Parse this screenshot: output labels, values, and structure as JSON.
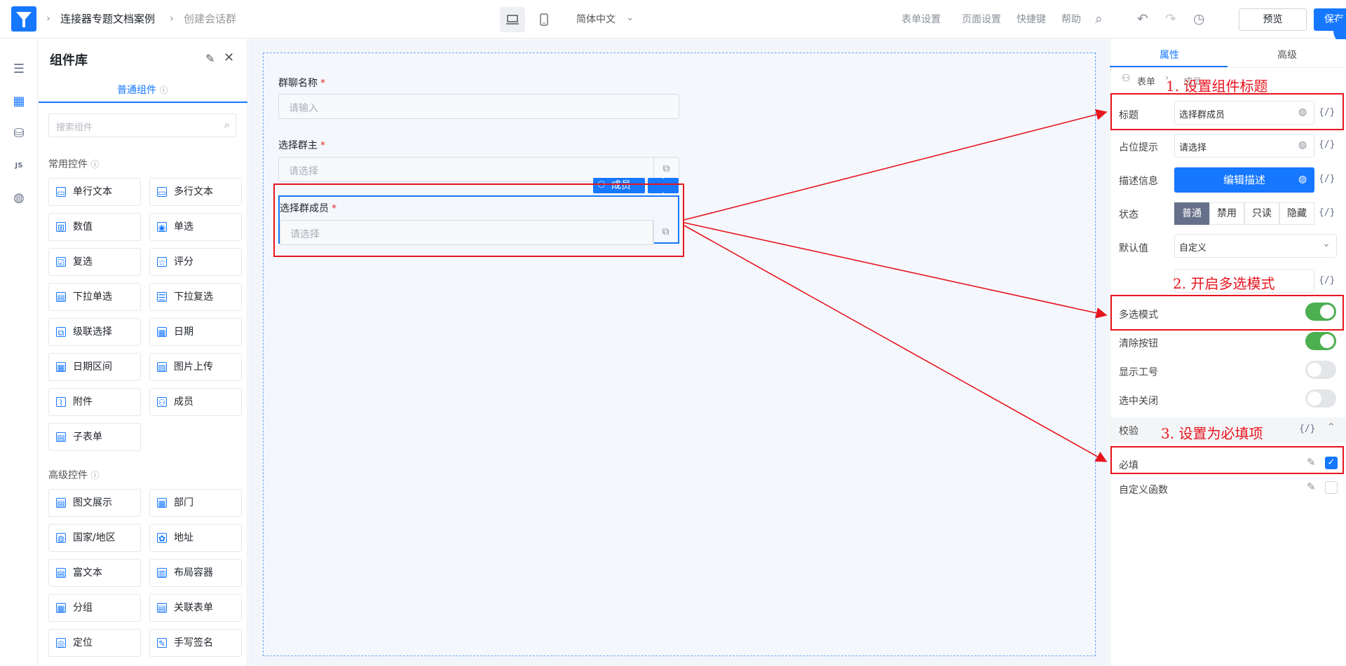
{
  "topbar": {
    "breadcrumb": [
      "连接器专题文档案例",
      "创建会话群"
    ],
    "language": "简体中文",
    "links": [
      "表单设置",
      "页面设置",
      "快捷键",
      "帮助"
    ],
    "preview_label": "预览",
    "save_label": "保存"
  },
  "library": {
    "title": "组件库",
    "tab": "普通组件",
    "search_placeholder": "搜索组件",
    "common_title": "常用控件",
    "common": [
      "单行文本",
      "多行文本",
      "数值",
      "单选",
      "复选",
      "评分",
      "下拉单选",
      "下拉复选",
      "级联选择",
      "日期",
      "日期区间",
      "图片上传",
      "附件",
      "成员",
      "子表单"
    ],
    "advanced_title": "高级控件",
    "advanced": [
      "图文展示",
      "部门",
      "国家/地区",
      "地址",
      "富文本",
      "布局容器",
      "分组",
      "关联表单",
      "定位",
      "手写签名"
    ]
  },
  "form": {
    "fields": [
      {
        "label": "群聊名称",
        "placeholder": "请输入"
      },
      {
        "label": "选择群主",
        "placeholder": "请选择"
      },
      {
        "label": "选择群成员",
        "placeholder": "请选择"
      }
    ],
    "selected_tag": "成员"
  },
  "props": {
    "tabs": [
      "属性",
      "高级"
    ],
    "crumb_root": "表单",
    "crumb_leaf": "成员",
    "title_label": "标题",
    "title_value": "选择群成员",
    "placeholder_label": "占位提示",
    "placeholder_value": "请选择",
    "desc_label": "描述信息",
    "desc_button": "编辑描述",
    "state_label": "状态",
    "states": [
      "普通",
      "禁用",
      "只读",
      "隐藏"
    ],
    "default_label": "默认值",
    "default_value": "自定义",
    "multi_label": "多选模式",
    "clear_label": "清除按钮",
    "showid_label": "显示工号",
    "closeonsel_label": "选中关闭",
    "validate_label": "校验",
    "required_label": "必填",
    "customfn_label": "自定义函数",
    "code_glyph": "{/}",
    "toggles": {
      "multi": true,
      "clear": true,
      "showid": false,
      "closeonsel": false
    },
    "required_checked": true,
    "customfn_checked": false
  },
  "annotations": [
    "1. 设置组件标题",
    "2. 开启多选模式",
    "3. 设置为必填项"
  ],
  "colors": {
    "accent": "#1677ff",
    "annotation": "#e8141e",
    "toggle_on": "#4caf50",
    "toggle_off": "#e3e5e8"
  }
}
